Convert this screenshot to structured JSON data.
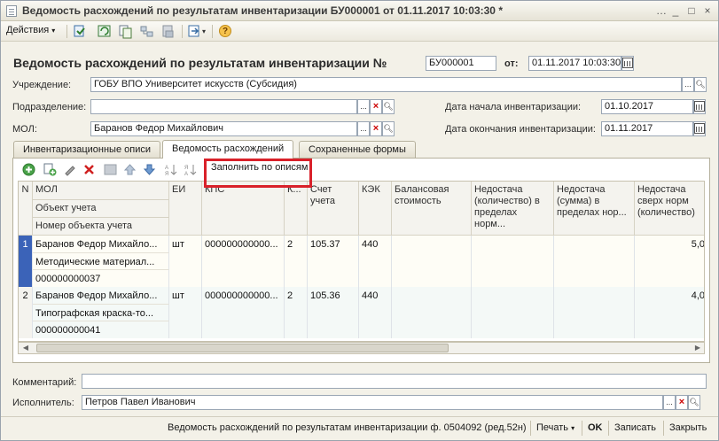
{
  "window": {
    "title": "Ведомость расхождений по результатам инвентаризации БУ000001 от 01.11.2017 10:03:30 *",
    "controls": [
      "…",
      "_",
      "□",
      "×"
    ]
  },
  "toolbar": {
    "actions_label": "Действия",
    "help_label": "?"
  },
  "header": {
    "doc_title": "Ведомость расхождений по результатам инвентаризации №",
    "number": "БУ000001",
    "date_label": "от:",
    "date": "01.11.2017 10:03:30",
    "institution_label": "Учреждение:",
    "institution": "ГОБУ ВПО Университет искусств (Субсидия)",
    "department_label": "Подразделение:",
    "department": "",
    "mol_label": "МОЛ:",
    "mol": "Баранов Федор Михайлович",
    "inv_start_label": "Дата начала инвентаризации:",
    "inv_start": "01.10.2017",
    "inv_end_label": "Дата окончания инвентаризации:",
    "inv_end": "01.11.2017"
  },
  "tabs": [
    {
      "label": "Инвентаризационные описи"
    },
    {
      "label": "Ведомость расхождений"
    },
    {
      "label": "Сохраненные формы"
    }
  ],
  "table_toolbar": {
    "fill_label": "Заполнить по описям"
  },
  "table": {
    "headers": {
      "n": "N",
      "mol": "МОЛ",
      "object": "Объект учета",
      "object_number": "Номер объекта учета",
      "ei": "ЕИ",
      "kps": "КПС",
      "k": "К...",
      "account": "Счет учета",
      "kek": "КЭК",
      "balance": "Балансовая стоимость",
      "short_qty": "Недостача (количество) в пределах норм...",
      "short_sum": "Недостача (сумма) в пределах нор...",
      "short_over": "Недостача сверх норм (количество)"
    },
    "rows": [
      {
        "n": "1",
        "mol": "Баранов Федор Михайло...",
        "object": "Методические материал...",
        "object_number": "000000000037",
        "ei": "шт",
        "kps": "000000000000...",
        "k": "2",
        "account": "105.37",
        "kek": "440",
        "balance": "",
        "short_qty": "",
        "short_sum": "",
        "short_over": "5,0"
      },
      {
        "n": "2",
        "mol": "Баранов Федор Михайло...",
        "object": "Типографская краска-то...",
        "object_number": "000000000041",
        "ei": "шт",
        "kps": "000000000000...",
        "k": "2",
        "account": "105.36",
        "kek": "440",
        "balance": "",
        "short_qty": "",
        "short_sum": "",
        "short_over": "4,0"
      }
    ]
  },
  "bottom": {
    "comment_label": "Комментарий:",
    "comment": "",
    "executor_label": "Исполнитель:",
    "executor": "Петров Павел Иванович"
  },
  "footer": {
    "report_label": "Ведомость расхождений по результатам инвентаризации ф. 0504092 (ред.52н)",
    "print_label": "Печать",
    "ok_label": "OK",
    "save_label": "Записать",
    "close_label": "Закрыть"
  },
  "colors": {
    "highlight": "#d9212a",
    "selected_row_marker": "#3b63b8",
    "window_bg": "#f3f1e8"
  }
}
